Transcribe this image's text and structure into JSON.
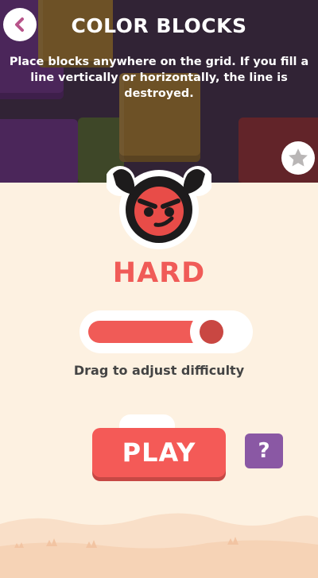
{
  "header": {
    "title": "COLOR BLOCKS",
    "description": "Place blocks anywhere on the grid. If you fill a line vertically or horizontally, the line is destroyed.",
    "back_icon": "chevron-left-icon",
    "star_icon": "star-icon"
  },
  "avatar": {
    "icon": "devil-face-icon"
  },
  "difficulty": {
    "label": "HARD",
    "level_fraction": 0.85,
    "caption": "Drag to adjust difficulty"
  },
  "actions": {
    "play_label": "PLAY",
    "help_label": "?"
  },
  "colors": {
    "accent": "#f05b57",
    "help": "#8a58a4",
    "background": "#fdf1e1",
    "back_icon": "#b8548a"
  }
}
